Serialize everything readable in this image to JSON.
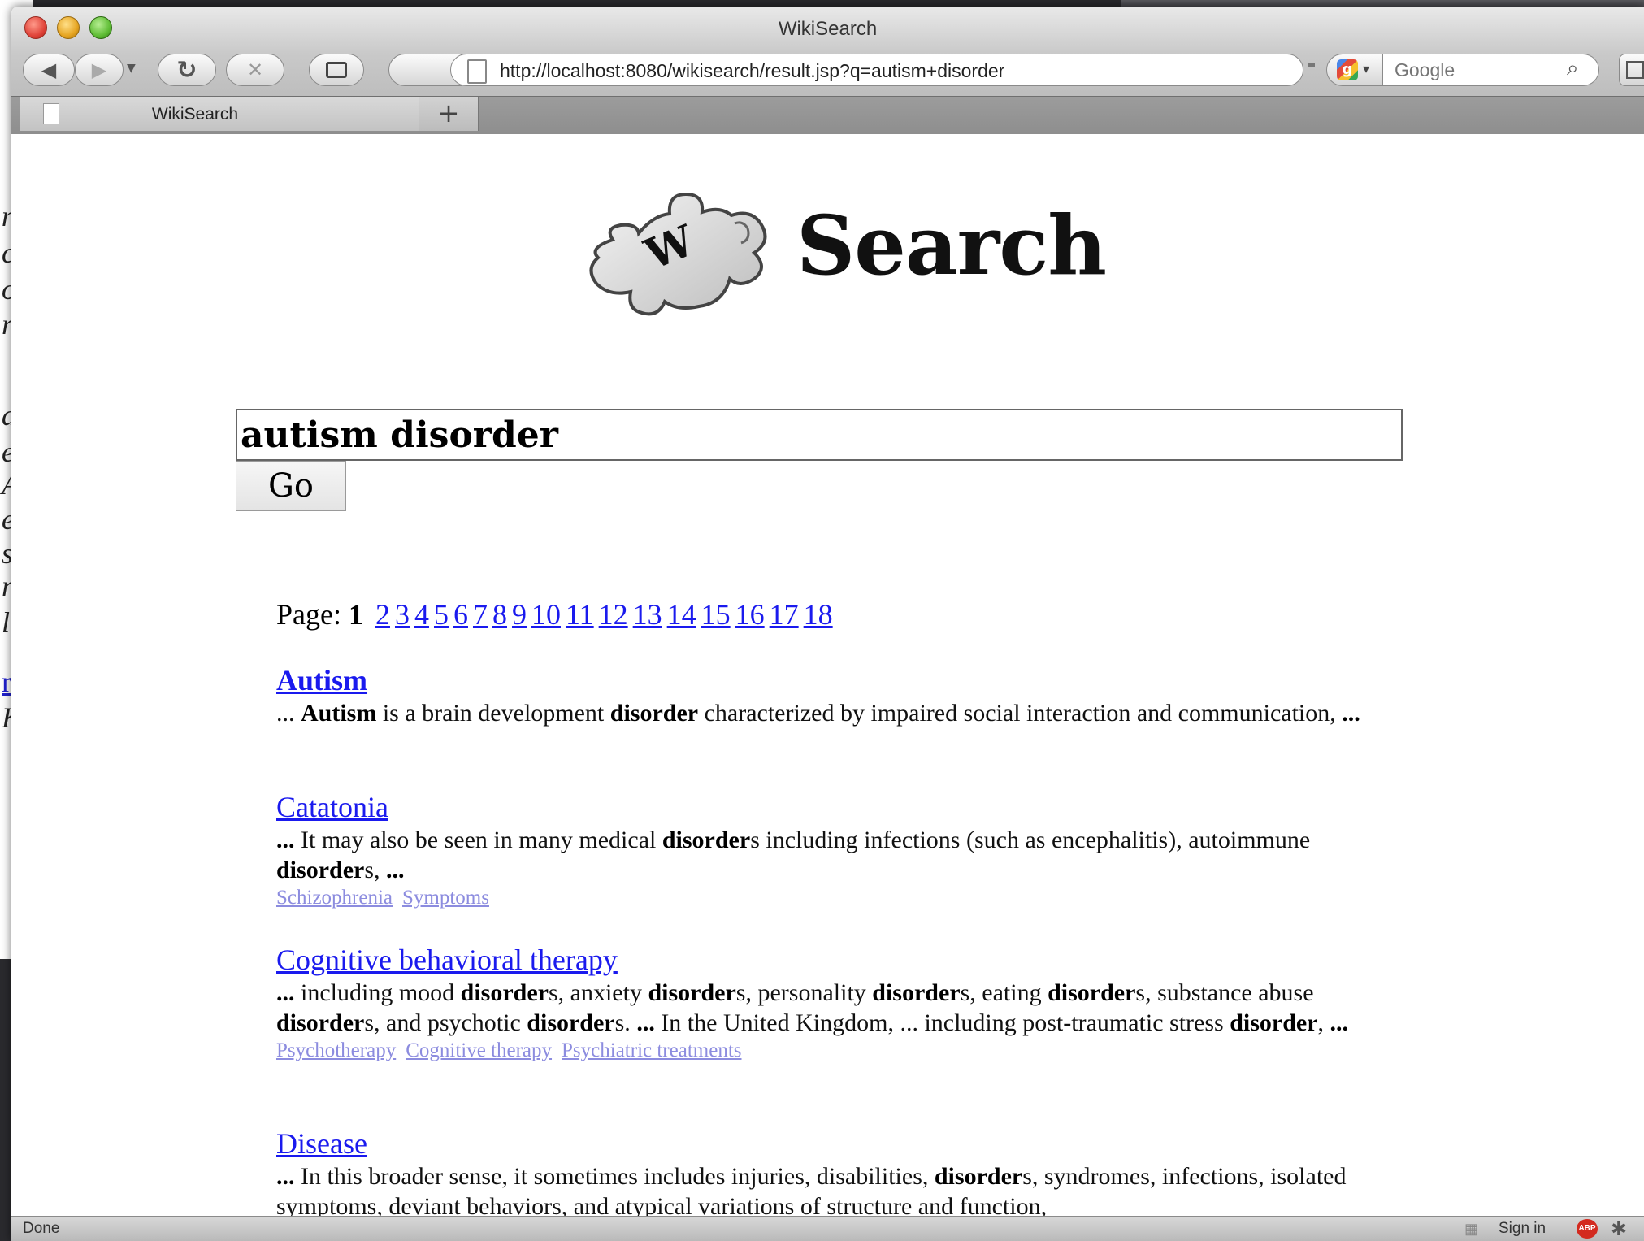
{
  "window": {
    "title": "WikiSearch"
  },
  "toolbar": {
    "back_icon": "◀",
    "forward_icon": "▶",
    "reload_icon": "↻",
    "stop_icon": "✕",
    "url": "http://localhost:8080/wikisearch/result.jsp?q=autism+disorder",
    "search_placeholder": "Google"
  },
  "tabs": [
    {
      "label": "WikiSearch"
    }
  ],
  "new_tab_label": "+",
  "logo": {
    "text": "Search",
    "puzzle_letter": "W"
  },
  "search": {
    "query": "autism disorder",
    "go_label": "Go"
  },
  "pager": {
    "label": "Page:",
    "current": "1",
    "pages": [
      "2",
      "3",
      "4",
      "5",
      "6",
      "7",
      "8",
      "9",
      "10",
      "11",
      "12",
      "13",
      "14",
      "15",
      "16",
      "17",
      "18"
    ]
  },
  "results": [
    {
      "title": "Autism",
      "snippet_html": "... <b>Autism</b> is a brain development <b>disorder</b> characterized by impaired social interaction and communication, <b>...</b>",
      "categories": []
    },
    {
      "title": "Catatonia",
      "snippet_html": "<b>...</b> It may also be seen in many medical <b>disorder</b>s including infections (such as encephalitis), autoimmune <b>disorder</b>s, <b>...</b>",
      "categories": [
        "Schizophrenia",
        "Symptoms"
      ]
    },
    {
      "title": "Cognitive behavioral therapy",
      "snippet_html": "<b>...</b> including mood <b>disorder</b>s, anxiety <b>disorder</b>s, personality <b>disorder</b>s, eating <b>disorder</b>s, substance abuse <b>disorder</b>s, and psychotic <b>disorder</b>s. <b>...</b> In the United Kingdom, ... including post-traumatic stress <b>disorder</b>, <b>...</b>",
      "categories": [
        "Psychotherapy",
        "Cognitive therapy",
        "Psychiatric treatments"
      ]
    },
    {
      "title": "Disease",
      "snippet_html": "<b>...</b> In this broader sense, it sometimes includes injuries, disabilities, <b>disorder</b>s, syndromes, infections, isolated symptoms, deviant behaviors, and atypical variations of structure and function,",
      "categories": []
    }
  ],
  "statusbar": {
    "status": "Done",
    "signin": "Sign in",
    "abp_badge": "ABP"
  },
  "background_window": {
    "letters": [
      "n",
      "c",
      "o",
      "r",
      "a",
      "e",
      "A",
      "e",
      "s",
      "r",
      "l"
    ],
    "link_letter": "r",
    "last_letter": "K"
  },
  "colors": {
    "link": "#1a1aee",
    "category_link": "#8c8cdf",
    "chrome": "#c9c9c9"
  }
}
